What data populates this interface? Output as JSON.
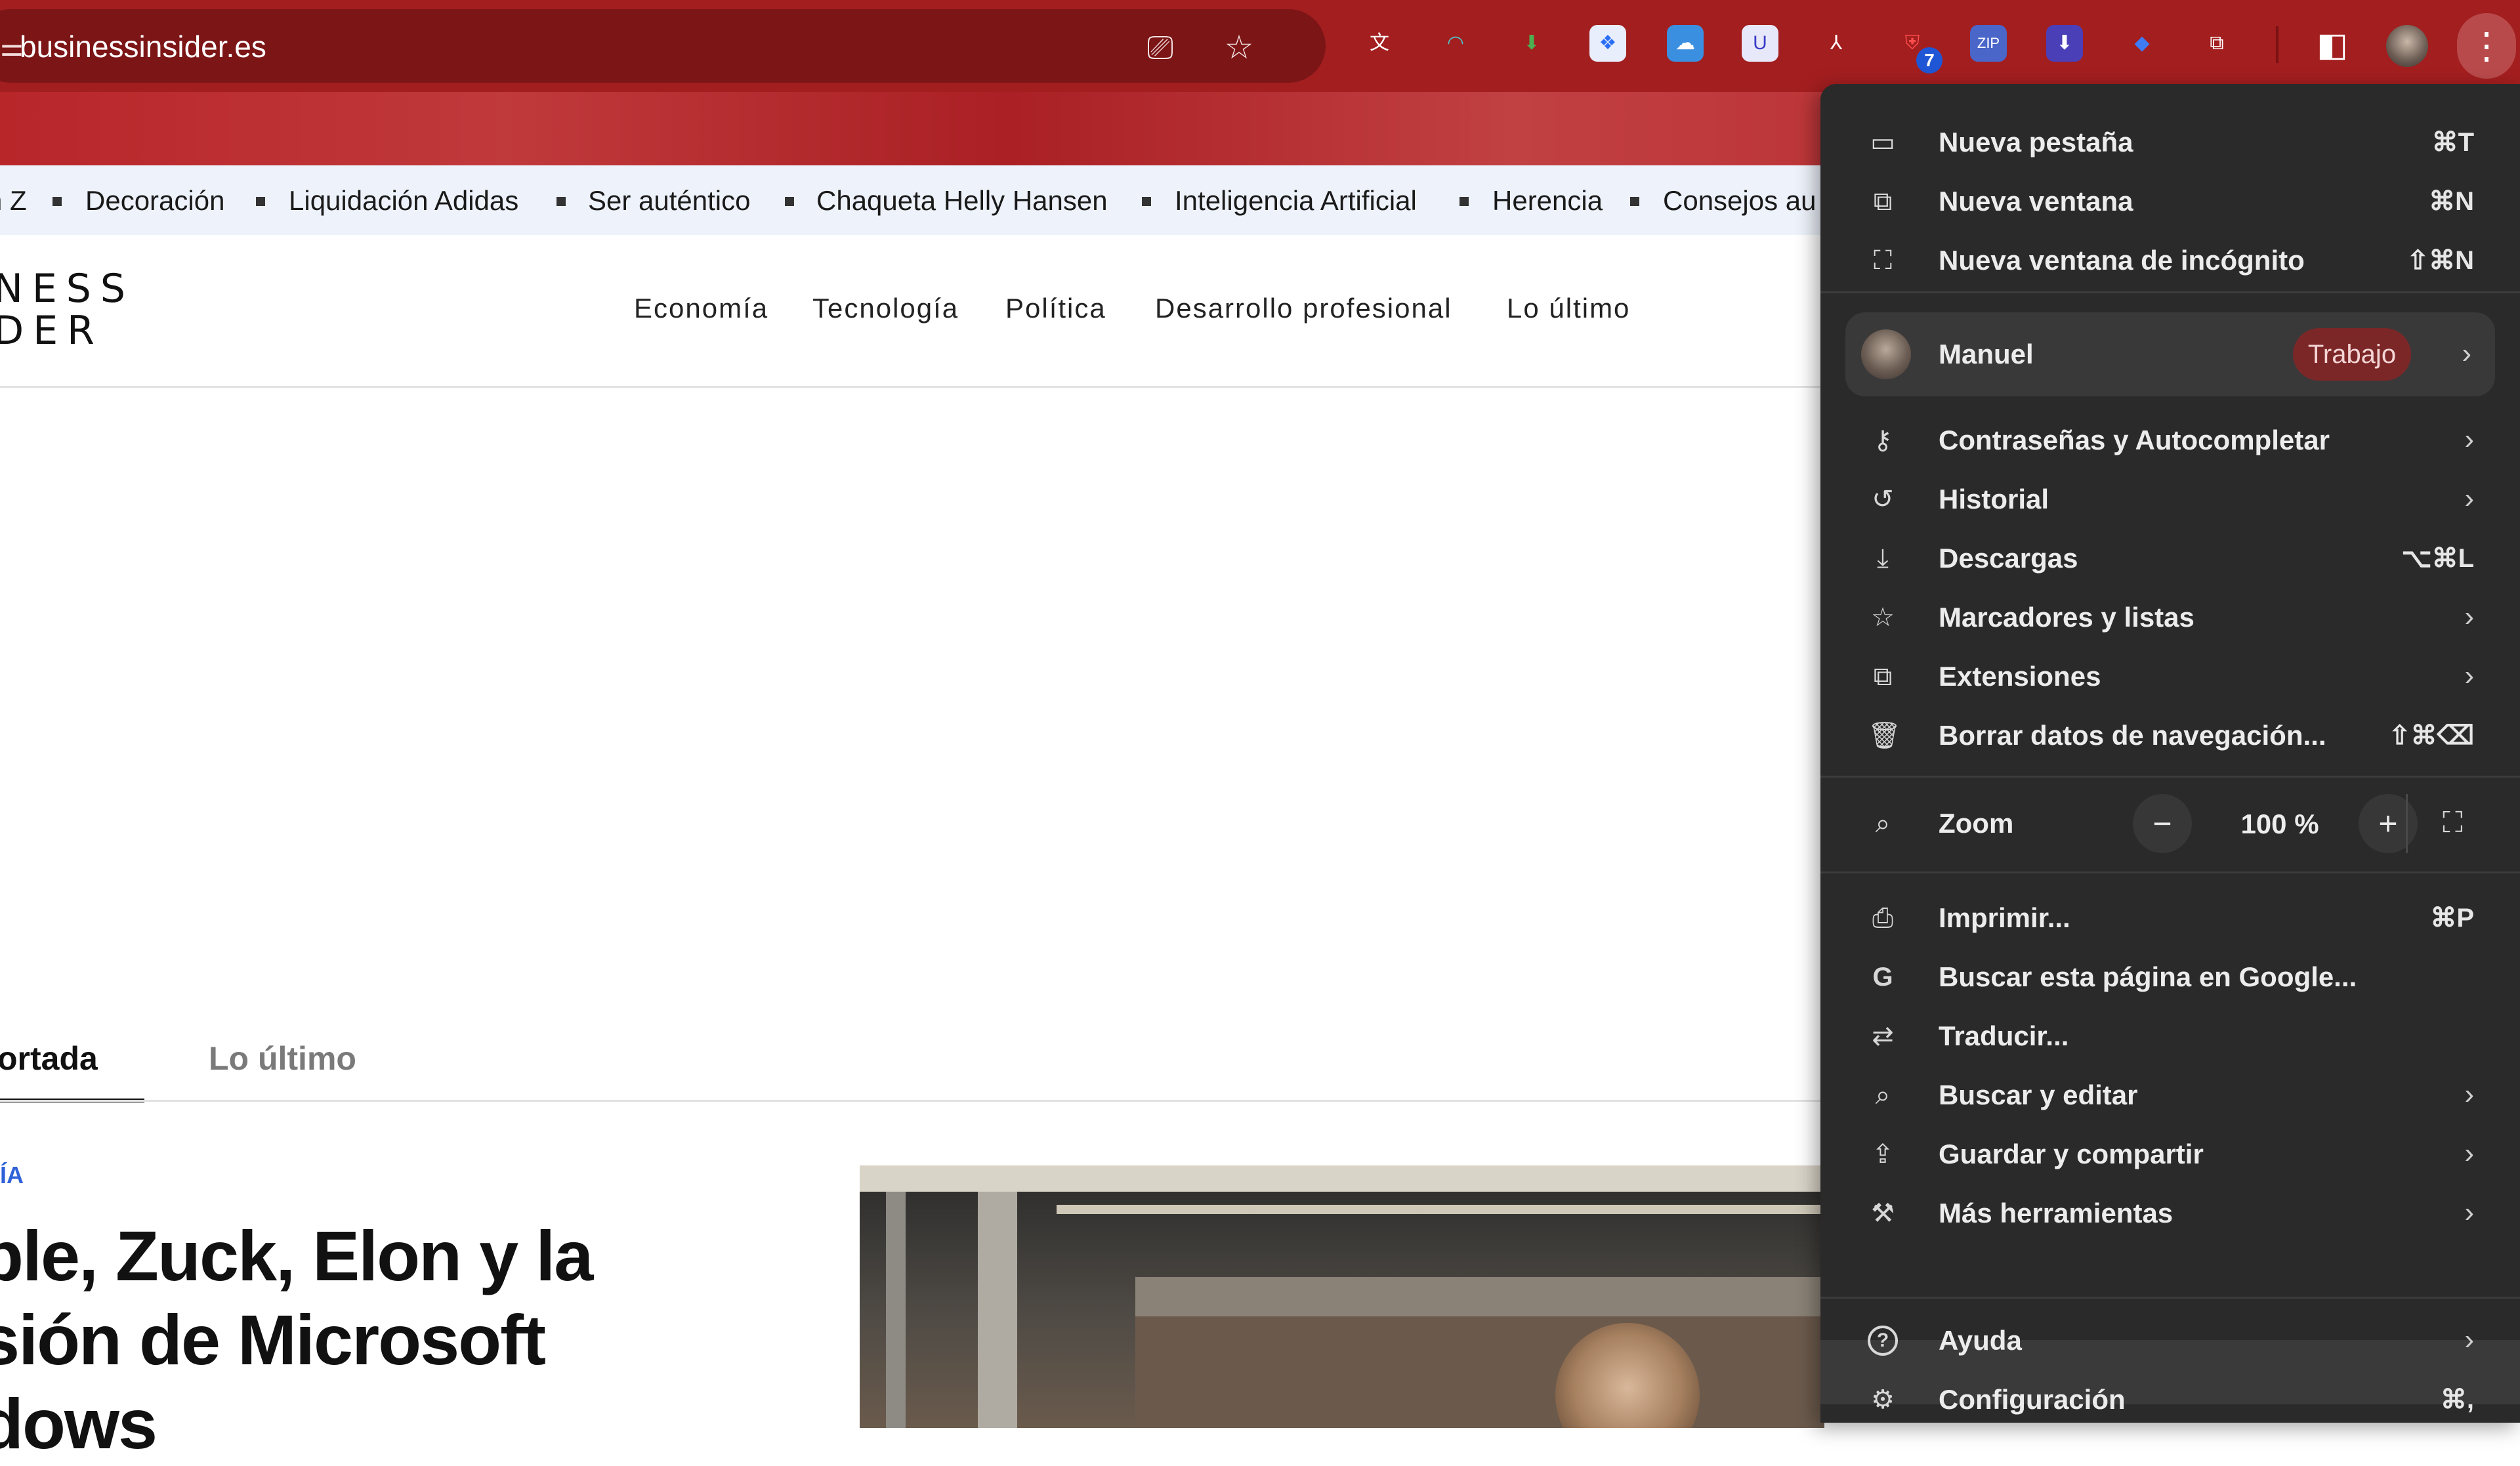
{
  "browser": {
    "url": "businessinsider.es",
    "site_icon": "tune-icon",
    "omnibox_icons": [
      "install-app-icon",
      "bookmark-star-icon"
    ],
    "extensions": [
      {
        "name": "translate-ext-icon",
        "glyph": "文",
        "color": "#ffffff",
        "bg": "transparent"
      },
      {
        "name": "arc-ext-icon",
        "glyph": "◠",
        "color": "#4fc3c8",
        "bg": "transparent"
      },
      {
        "name": "download-green-ext-icon",
        "glyph": "⬇",
        "color": "#4caf50",
        "bg": "transparent"
      },
      {
        "name": "dropbox-ext-icon",
        "glyph": "❖",
        "color": "#2a6ef5",
        "bg": "#e8eefc"
      },
      {
        "name": "cloud-ext-icon",
        "glyph": "☁",
        "color": "#ffffff",
        "bg": "#3b8fe0"
      },
      {
        "name": "u-ext-icon",
        "glyph": "U",
        "color": "#3b3fc7",
        "bg": "#e8e8fb"
      },
      {
        "name": "acrobat-ext-icon",
        "glyph": "⅄",
        "color": "#ffffff",
        "bg": "transparent"
      },
      {
        "name": "shield-ext-icon",
        "glyph": "⛨",
        "color": "#ff4d4d",
        "bg": "transparent"
      },
      {
        "name": "zip-ext-icon",
        "glyph": "ZIP",
        "color": "#ffffff",
        "bg": "#4a66c9"
      },
      {
        "name": "download-blue-ext-icon",
        "glyph": "⬇",
        "color": "#ffffff",
        "bg": "#4b3fb8"
      },
      {
        "name": "diamond-ext-icon",
        "glyph": "◆",
        "color": "#3d7cf5",
        "bg": "transparent"
      },
      {
        "name": "puzzle-icon",
        "glyph": "⧉",
        "color": "#ffffff",
        "bg": "transparent"
      }
    ],
    "badge_count": "7",
    "side_panel_icon": "side-panel-icon",
    "menu_icon": "more-vertical-icon"
  },
  "page": {
    "trending": [
      "n Z",
      "Decoración",
      "Liquidación Adidas",
      "Ser auténtico",
      "Chaqueta Helly Hansen",
      "Inteligencia Artificial",
      "Herencia",
      "Consejos au"
    ],
    "logo_lines": "NESS\nDER",
    "nav": [
      "Economía",
      "Tecnología",
      "Política",
      "Desarrollo profesional",
      "Lo último"
    ],
    "tabs": [
      "ortada",
      "Lo último"
    ],
    "category": "ÍA",
    "headline_lines": [
      "ple, Zuck, Elon y la",
      "sión de Microsoft",
      "dows"
    ]
  },
  "menu": {
    "group1": [
      {
        "icon": "new-tab-icon",
        "glyph": "▭",
        "label": "Nueva pestaña",
        "shortcut": "⌘T"
      },
      {
        "icon": "new-window-icon",
        "glyph": "⧉",
        "label": "Nueva ventana",
        "shortcut": "⌘N"
      },
      {
        "icon": "incognito-icon",
        "glyph": "⛶",
        "label": "Nueva ventana de incógnito",
        "shortcut": "⇧⌘N"
      }
    ],
    "profile": {
      "name": "Manuel",
      "tag": "Trabajo"
    },
    "group2": [
      {
        "icon": "key-icon",
        "glyph": "⚷",
        "label": "Contraseñas y Autocompletar",
        "chevron": true
      },
      {
        "icon": "history-icon",
        "glyph": "↺",
        "label": "Historial",
        "chevron": true
      },
      {
        "icon": "download-icon",
        "glyph": "⤓",
        "label": "Descargas",
        "shortcut": "⌥⌘L"
      },
      {
        "icon": "star-icon",
        "glyph": "☆",
        "label": "Marcadores y listas",
        "chevron": true
      },
      {
        "icon": "extensions-icon",
        "glyph": "⧉",
        "label": "Extensiones",
        "chevron": true
      },
      {
        "icon": "trash-icon",
        "glyph": "🗑",
        "label": "Borrar datos de navegación...",
        "shortcut": "⇧⌘⌫"
      }
    ],
    "zoom": {
      "label": "Zoom",
      "value": "100 %",
      "minus": "−",
      "plus": "+",
      "icon": "zoom-icon"
    },
    "group3": [
      {
        "icon": "print-icon",
        "glyph": "⎙",
        "label": "Imprimir...",
        "shortcut": "⌘P"
      },
      {
        "icon": "google-icon",
        "glyph": "G",
        "label": "Buscar esta página en Google...",
        "chevron": false
      },
      {
        "icon": "translate-icon",
        "glyph": "⇄",
        "label": "Traducir...",
        "chevron": false
      },
      {
        "icon": "find-edit-icon",
        "glyph": "⌕",
        "label": "Buscar y editar",
        "chevron": true
      },
      {
        "icon": "save-share-icon",
        "glyph": "⇪",
        "label": "Guardar y compartir",
        "chevron": true
      },
      {
        "icon": "toolbox-icon",
        "glyph": "⚒",
        "label": "Más herramientas",
        "chevron": true
      }
    ],
    "group4": [
      {
        "icon": "help-icon",
        "glyph": "?",
        "label": "Ayuda",
        "chevron": true
      },
      {
        "icon": "settings-icon",
        "glyph": "⚙",
        "label": "Configuración",
        "shortcut": "⌘,"
      }
    ]
  },
  "colors": {
    "chrome_red": "#a31e1f",
    "menu_bg": "#2b2a2b",
    "menu_text": "#ececec",
    "profile_pill": "#7c2727",
    "link_blue": "#2f62d8"
  }
}
